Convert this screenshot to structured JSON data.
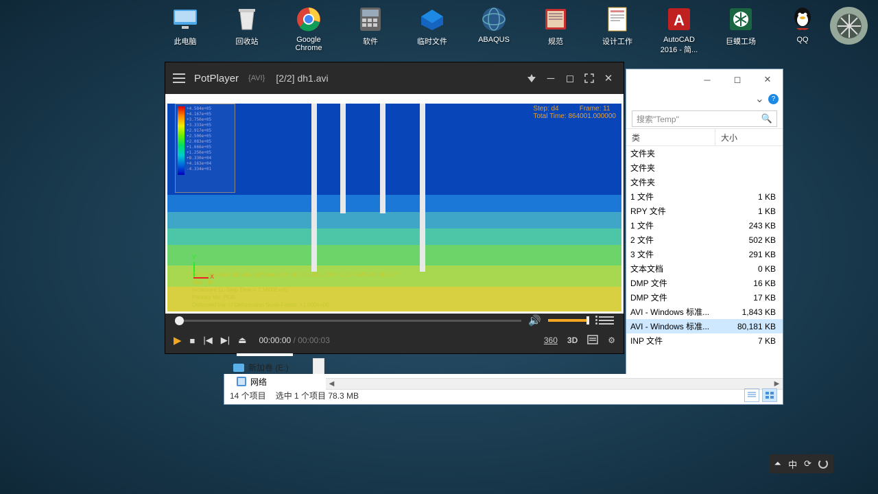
{
  "desktop": {
    "icons": [
      {
        "label": "此电脑"
      },
      {
        "label": "回收站"
      },
      {
        "label": "Google Chrome"
      },
      {
        "label": "软件"
      },
      {
        "label": "临时文件"
      },
      {
        "label": "ABAQUS"
      },
      {
        "label": "规范"
      },
      {
        "label": "设计工作"
      },
      {
        "label": "AutoCAD 2016 - 简..."
      },
      {
        "label": "巨蟆工场"
      },
      {
        "label": "QQ"
      }
    ]
  },
  "potplayer": {
    "app_name": "PotPlayer",
    "format": "{AVI}",
    "playlist_pos": "[2/2]",
    "filename": "dh1.avi",
    "time_current": "00:00:00",
    "time_total": "00:00:03",
    "buttons": {
      "r360": "360",
      "r3d": "3D"
    },
    "sim": {
      "step": "Step: d4",
      "frame": "Frame: 11",
      "total_time": "Total Time: 864001.000000",
      "odb": "ODB: dewater1.odb    Abaqus/Standard 6.14-1    Sat May 20 20:21:20 GMT+08:00 2017",
      "line2": "Step: d4",
      "line3": "Increment    11: Step Time =   2.1600E+05",
      "line4": "Primary Var: POR",
      "line5": "Deformed Var: U   Deformation Scale Factor: +1.000e+00",
      "legend": "+4.584e+05\n+4.167e+05\n+3.750e+05\n+3.333e+05\n+2.917e+05\n+2.500e+05\n+2.083e+05\n+1.666e+05\n+1.250e+05\n+8.330e+04\n+4.163e+04\n-4.334e+01"
    }
  },
  "explorer": {
    "search_placeholder": "搜索\"Temp\"",
    "col_type": "类",
    "col_size": "大小",
    "rows": [
      {
        "type": "文件夹",
        "size": ""
      },
      {
        "type": "文件夹",
        "size": ""
      },
      {
        "type": "文件夹",
        "size": ""
      },
      {
        "type": "1 文件",
        "size": "1 KB"
      },
      {
        "type": "RPY 文件",
        "size": "1 KB"
      },
      {
        "type": "1 文件",
        "size": "243 KB"
      },
      {
        "type": "2 文件",
        "size": "502 KB"
      },
      {
        "type": "3 文件",
        "size": "291 KB"
      },
      {
        "type": "文本文档",
        "size": "0 KB"
      },
      {
        "type": "DMP 文件",
        "size": "16 KB"
      },
      {
        "type": "DMP 文件",
        "size": "17 KB"
      },
      {
        "type": "AVI - Windows 标准...",
        "size": "1,843 KB"
      },
      {
        "type": "AVI - Windows 标准...",
        "size": "80,181 KB"
      },
      {
        "type": "INP 文件",
        "size": "7 KB"
      }
    ],
    "sidebar_drive": "新加卷 (E:)",
    "sidebar_network": "网络",
    "status_count": "14 个项目",
    "status_selected": "选中 1 个项目  78.3 MB"
  },
  "tray": {
    "ime": "中"
  }
}
